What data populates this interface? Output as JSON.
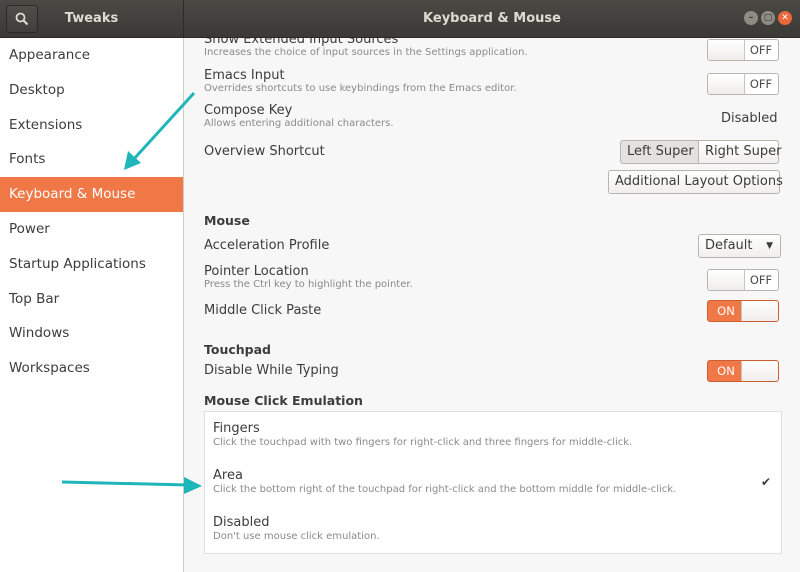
{
  "header": {
    "app_title": "Tweaks",
    "window_title": "Keyboard & Mouse",
    "search_icon": "search-icon"
  },
  "sidebar": {
    "items": [
      {
        "label": "Appearance"
      },
      {
        "label": "Desktop"
      },
      {
        "label": "Extensions"
      },
      {
        "label": "Fonts"
      },
      {
        "label": "Keyboard & Mouse",
        "active": true
      },
      {
        "label": "Power"
      },
      {
        "label": "Startup Applications"
      },
      {
        "label": "Top Bar"
      },
      {
        "label": "Windows"
      },
      {
        "label": "Workspaces"
      }
    ]
  },
  "keyboard": {
    "show_extended": {
      "label": "Show Extended Input Sources",
      "desc": "Increases the choice of input sources in the Settings application.",
      "state": "OFF"
    },
    "emacs": {
      "label": "Emacs Input",
      "desc": "Overrides shortcuts to use keybindings from the Emacs editor.",
      "state": "OFF"
    },
    "compose": {
      "label": "Compose Key",
      "desc": "Allows entering additional characters.",
      "value": "Disabled"
    },
    "overview": {
      "label": "Overview Shortcut",
      "left": "Left Super",
      "right": "Right Super",
      "selected": "Left Super"
    },
    "additional_layout": "Additional Layout Options"
  },
  "mouse": {
    "section": "Mouse",
    "accel": {
      "label": "Acceleration Profile",
      "value": "Default"
    },
    "pointer": {
      "label": "Pointer Location",
      "desc": "Press the Ctrl key to highlight the pointer.",
      "state": "OFF"
    },
    "middle_click": {
      "label": "Middle Click Paste",
      "state": "ON"
    }
  },
  "touchpad": {
    "section": "Touchpad",
    "disable_typing": {
      "label": "Disable While Typing",
      "state": "ON"
    },
    "emulation_section": "Mouse Click Emulation",
    "options": [
      {
        "title": "Fingers",
        "desc": "Click the touchpad with two fingers for right-click and three fingers for middle-click.",
        "checked": false
      },
      {
        "title": "Area",
        "desc": "Click the bottom right of the touchpad for right-click and the bottom middle for middle-click.",
        "checked": true
      },
      {
        "title": "Disabled",
        "desc": "Don't use mouse click emulation.",
        "checked": false
      }
    ],
    "check_glyph": "✔"
  },
  "colors": {
    "accent": "#f07746",
    "header": "#3f3e3a",
    "arrow": "#1fb6b9"
  }
}
